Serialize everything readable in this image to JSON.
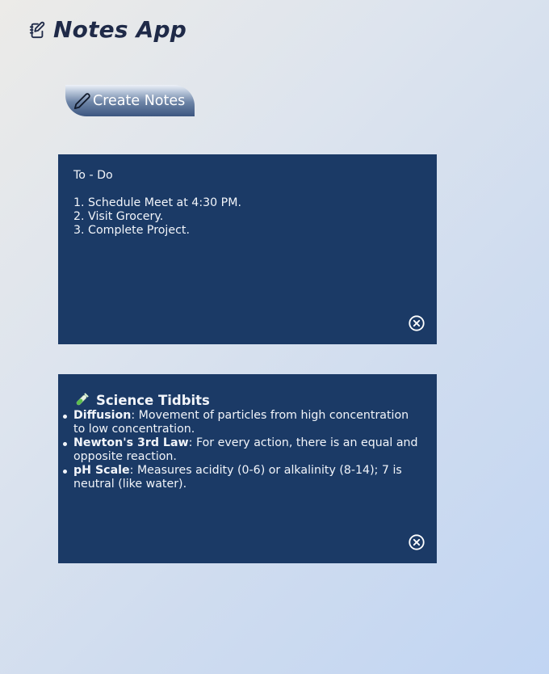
{
  "header": {
    "title": "Notes App",
    "icon": "notebook-edit-icon"
  },
  "toolbar": {
    "create_label": "Create Notes",
    "create_icon": "pencil-icon"
  },
  "notes": [
    {
      "title": "To - Do",
      "lines": [
        "1. Schedule Meet at 4:30 PM.",
        "2. Visit Grocery.",
        "3. Complete Project."
      ],
      "close_icon": "close-circle-icon"
    },
    {
      "title": "Science Tidbits",
      "title_icon": "test-tube-icon",
      "items": [
        {
          "term": "Diffusion",
          "text": ": Movement of particles from high concentration to low concentration."
        },
        {
          "term": "Newton's 3rd Law",
          "text": ": For every action, there is an equal and opposite reaction."
        },
        {
          "term": "pH Scale",
          "text": ": Measures acidity (0-6) or alkalinity (8-14); 7 is neutral (like water)."
        }
      ],
      "close_icon": "close-circle-icon"
    }
  ],
  "colors": {
    "note_background": "#1b3a66",
    "title": "#1f2a48",
    "note_text": "#f2f5fa"
  }
}
